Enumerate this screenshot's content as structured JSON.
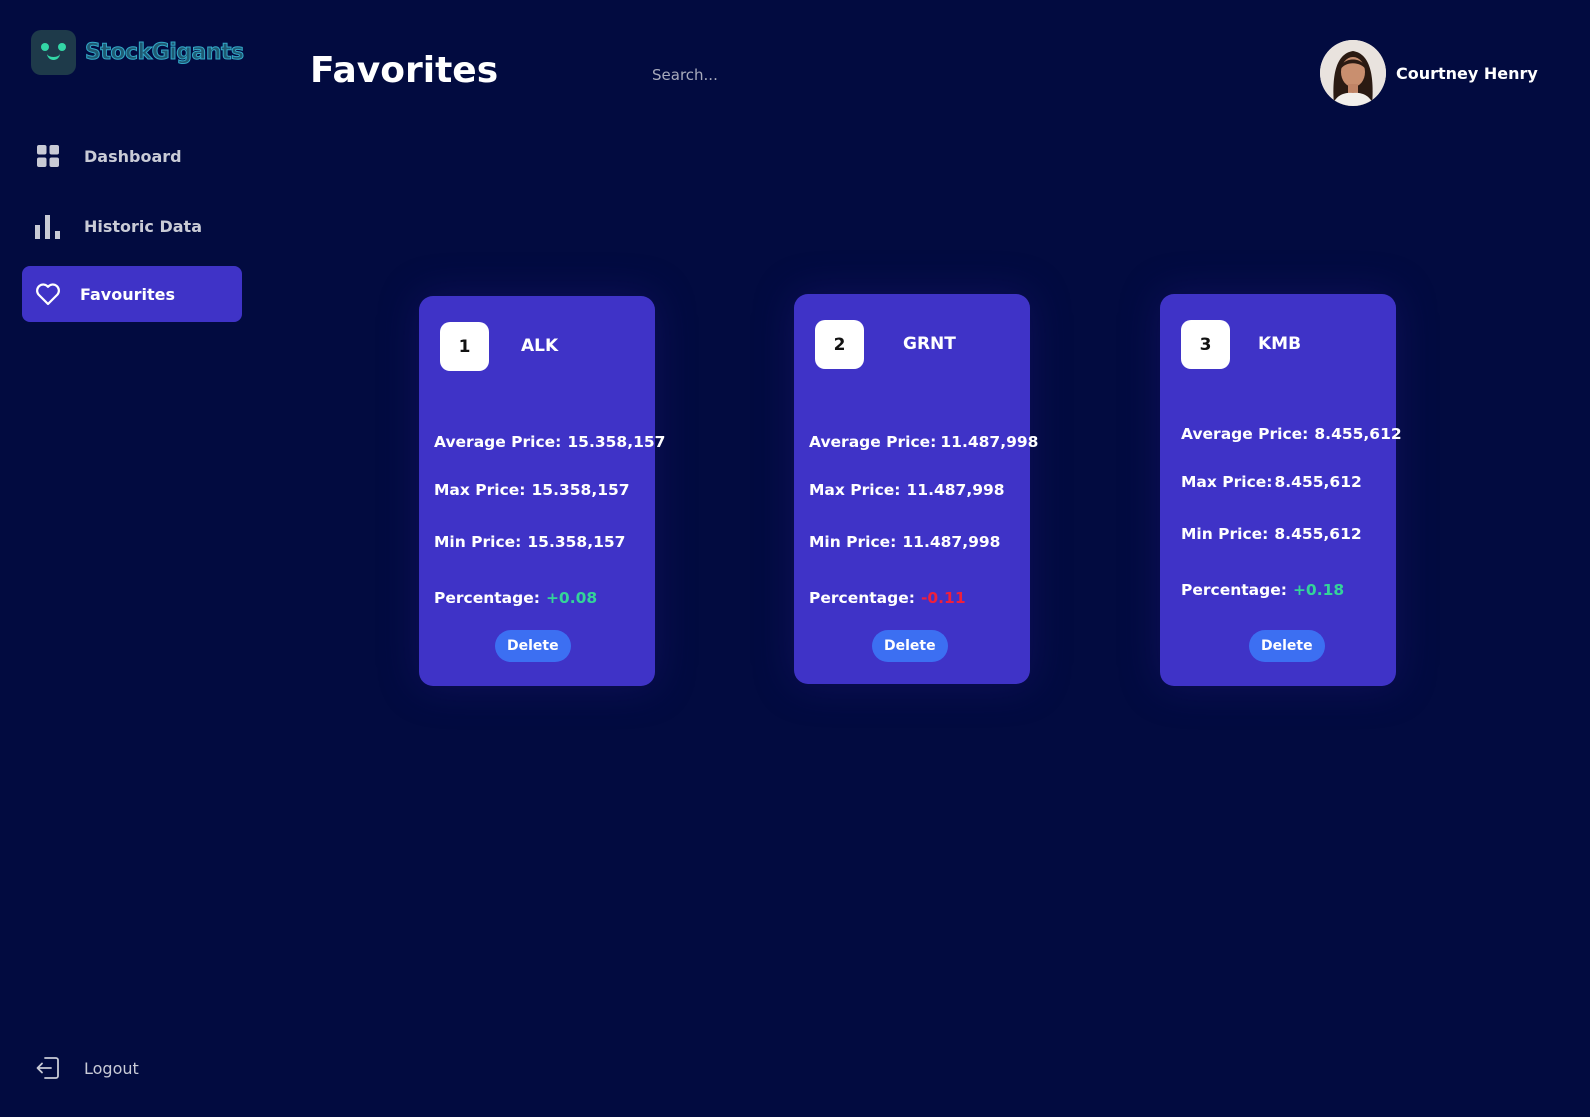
{
  "brand": {
    "name": "StockGigants"
  },
  "sidebar": {
    "items": [
      {
        "label": "Dashboard",
        "icon": "grid-icon"
      },
      {
        "label": "Historic Data",
        "icon": "bar-chart-icon"
      },
      {
        "label": "Favourites",
        "icon": "heart-icon",
        "active": true
      }
    ],
    "logout": {
      "label": "Logout",
      "icon": "logout-icon"
    }
  },
  "header": {
    "title": "Favorites",
    "search_placeholder": "Search...",
    "user_name": "Courtney Henry"
  },
  "cards": [
    {
      "rank": "1",
      "ticker": "ALK",
      "avg_label": "Average Price:",
      "avg": "15.358,157",
      "max_label": "Max Price:",
      "max": "15.358,157",
      "min_label": "Min Price:",
      "min": "15.358,157",
      "pct_label": "Percentage:",
      "pct": "+0.08",
      "pct_color": "#34d399",
      "delete_label": "Delete"
    },
    {
      "rank": "2",
      "ticker": "GRNT",
      "avg_label": "Average Price:",
      "avg": "11.487,998",
      "max_label": "Max Price:",
      "max": "11.487,998",
      "min_label": "Min Price:",
      "min": "11.487,998",
      "pct_label": "Percentage:",
      "pct": "-0.11",
      "pct_color": "#ef1f3c",
      "delete_label": "Delete"
    },
    {
      "rank": "3",
      "ticker": "KMB",
      "avg_label": "Average Price:",
      "avg": "8.455,612",
      "max_label": "Max Price:",
      "max": "8.455,612",
      "min_label": "Min Price:",
      "min": "8.455,612",
      "pct_label": "Percentage:",
      "pct": "+0.18",
      "pct_color": "#34d399",
      "delete_label": "Delete"
    }
  ],
  "colors": {
    "background": "#020b40",
    "card": "#3f33c7",
    "active_nav": "#3f33c7",
    "delete_button": "#3c6ff2",
    "positive": "#34d399",
    "negative": "#ef1f3c"
  }
}
